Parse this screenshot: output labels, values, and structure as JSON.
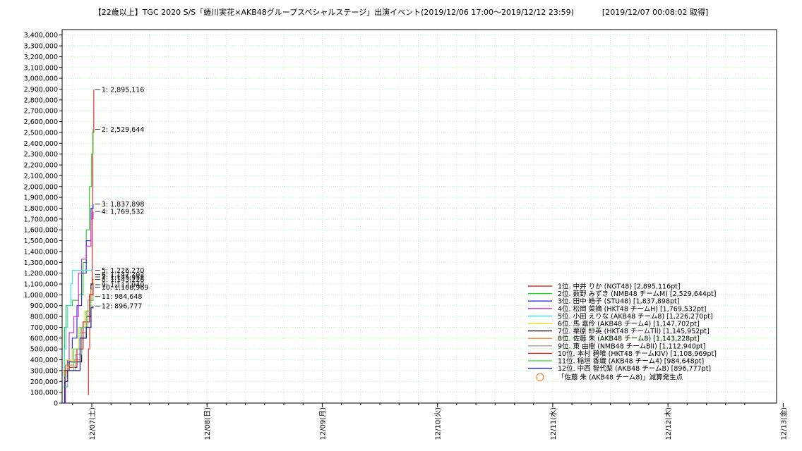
{
  "title": "【22歳以上】TGC 2020 S/S「蜷川実花×AKB48グループスペシャルステージ」出演イベント(2019/12/06 17:00〜2019/12/12 23:59)",
  "timestamp": "[2019/12/07 00:08:02 取得]",
  "chart_data": {
    "type": "line",
    "ylim": [
      0,
      3450000
    ],
    "grid": true,
    "legend_position": "bottom-right",
    "y_ticks": [
      "0",
      "100,000",
      "200,000",
      "300,000",
      "400,000",
      "500,000",
      "600,000",
      "700,000",
      "800,000",
      "900,000",
      "1,000,000",
      "1,100,000",
      "1,200,000",
      "1,300,000",
      "1,400,000",
      "1,500,000",
      "1,600,000",
      "1,700,000",
      "1,800,000",
      "1,900,000",
      "2,000,000",
      "2,100,000",
      "2,200,000",
      "2,300,000",
      "2,400,000",
      "2,500,000",
      "2,600,000",
      "2,700,000",
      "2,800,000",
      "2,900,000",
      "3,000,000",
      "3,100,000",
      "3,200,000",
      "3,300,000",
      "3,400,000"
    ],
    "x_ticks": [
      "12/07(土)",
      "12/08(日)",
      "12/09(月)",
      "12/10(火)",
      "12/11(水)",
      "12/12(木)",
      "12/13(金)"
    ],
    "annotations": [
      {
        "text": "1: 2,895,116",
        "value": 2895116
      },
      {
        "text": "2: 2,529,644",
        "value": 2529644
      },
      {
        "text": "3: 1,837,898",
        "value": 1837898
      },
      {
        "text": "4: 1,769,532",
        "value": 1769532
      },
      {
        "text": "5: 1,226,270",
        "value": 1226270
      },
      {
        "text": "6: 1,147,702",
        "value": 1147702
      },
      {
        "text": "7: 1,145,952",
        "value": 1145952
      },
      {
        "text": "8: 1,143,228",
        "value": 1143228
      },
      {
        "text": "9: 1,112,940",
        "value": 1112940
      },
      {
        "text": "10: 1,108,969",
        "value": 1108969
      },
      {
        "text": "11: 984,648",
        "value": 984648
      },
      {
        "text": "12: 896,777",
        "value": 896777
      }
    ],
    "series": [
      {
        "name": "1位. 中井 りか (NGT48) [2,895,116pt]",
        "color": "#e03030",
        "points": [
          [
            0.8,
            80000
          ],
          [
            0.82,
            500000
          ],
          [
            0.86,
            700000
          ],
          [
            0.9,
            1100000
          ],
          [
            0.94,
            1800000
          ],
          [
            0.96,
            2500000
          ],
          [
            0.99,
            2895116
          ]
        ]
      },
      {
        "name": "2位. 薮野 みずき (NMB48 チームM) [2,529,644pt]",
        "color": "#30d030",
        "points": [
          [
            0.02,
            0
          ],
          [
            0.05,
            700000
          ],
          [
            0.1,
            900000
          ],
          [
            0.3,
            950000
          ],
          [
            0.5,
            1000000
          ],
          [
            0.65,
            1300000
          ],
          [
            0.75,
            1600000
          ],
          [
            0.85,
            2000000
          ],
          [
            0.92,
            2300000
          ],
          [
            0.97,
            2529644
          ]
        ]
      },
      {
        "name": "3位. 田中 皓子 (STU48) [1,837,898pt]",
        "color": "#3030e0",
        "points": [
          [
            0.02,
            0
          ],
          [
            0.06,
            250000
          ],
          [
            0.15,
            400000
          ],
          [
            0.3,
            600000
          ],
          [
            0.45,
            900000
          ],
          [
            0.6,
            1200000
          ],
          [
            0.75,
            1500000
          ],
          [
            0.9,
            1800000
          ],
          [
            0.97,
            1837898
          ]
        ]
      },
      {
        "name": "4位. 松岡 菜摘 (HKT48 チームH) [1,769,532pt]",
        "color": "#d030d0",
        "points": [
          [
            0.02,
            0
          ],
          [
            0.08,
            350000
          ],
          [
            0.2,
            650000
          ],
          [
            0.35,
            800000
          ],
          [
            0.5,
            1200000
          ],
          [
            0.6,
            1330000
          ],
          [
            0.75,
            1450000
          ],
          [
            0.9,
            1700000
          ],
          [
            0.97,
            1769532
          ]
        ]
      },
      {
        "name": "5位. 小田 えりな (AKB48 チーム8) [1,226,270pt]",
        "color": "#40e0e0",
        "points": [
          [
            0.02,
            300000
          ],
          [
            0.05,
            500000
          ],
          [
            0.1,
            700000
          ],
          [
            0.15,
            900000
          ],
          [
            0.25,
            1100000
          ],
          [
            0.3,
            1226270
          ],
          [
            0.97,
            1226270
          ]
        ]
      },
      {
        "name": "6位. 馬 嘉伶 (AKB48 チーム4) [1,147,702pt]",
        "color": "#e0e030",
        "points": [
          [
            0.02,
            200000
          ],
          [
            0.1,
            400000
          ],
          [
            0.3,
            500000
          ],
          [
            0.5,
            700000
          ],
          [
            0.7,
            850000
          ],
          [
            0.85,
            1000000
          ],
          [
            0.97,
            1147702
          ]
        ]
      },
      {
        "name": "7位. 栗原 紗英 (HKT48 チームTII) [1,145,952pt]",
        "color": "#202020",
        "points": [
          [
            0.02,
            300000
          ],
          [
            0.2,
            380000
          ],
          [
            0.5,
            380000
          ],
          [
            0.6,
            600000
          ],
          [
            0.75,
            800000
          ],
          [
            0.9,
            1100000
          ],
          [
            0.97,
            1145952
          ]
        ]
      },
      {
        "name": "8位. 佐藤 朱 (AKB48 チーム8) [1,143,228pt]",
        "color": "#f08030",
        "points": [
          [
            0.02,
            280000
          ],
          [
            0.15,
            350000
          ],
          [
            0.35,
            400000
          ],
          [
            0.55,
            650000
          ],
          [
            0.75,
            850000
          ],
          [
            0.9,
            1050000
          ],
          [
            0.97,
            1143228
          ]
        ]
      },
      {
        "name": "9位. 東 由樹 (NMB48 チームBII) [1,112,940pt]",
        "color": "#a0a0a0",
        "points": [
          [
            0.02,
            250000
          ],
          [
            0.15,
            300000
          ],
          [
            0.4,
            450000
          ],
          [
            0.6,
            700000
          ],
          [
            0.8,
            950000
          ],
          [
            0.97,
            1112940
          ]
        ]
      },
      {
        "name": "10位. 本村 碧唯 (HKT48 チームKIV) [1,108,969pt]",
        "color": "#c02020",
        "points": [
          [
            0.02,
            300000
          ],
          [
            0.2,
            330000
          ],
          [
            0.45,
            500000
          ],
          [
            0.65,
            750000
          ],
          [
            0.85,
            1000000
          ],
          [
            0.97,
            1108969
          ]
        ]
      },
      {
        "name": "11位. 稲垣 香織 (AKB48 チーム4) [984,648pt]",
        "color": "#60d060",
        "points": [
          [
            0.02,
            150000
          ],
          [
            0.15,
            300000
          ],
          [
            0.35,
            500000
          ],
          [
            0.55,
            700000
          ],
          [
            0.75,
            850000
          ],
          [
            0.9,
            950000
          ],
          [
            0.97,
            984648
          ]
        ]
      },
      {
        "name": "12位. 中西 智代梨 (AKB48 チームB) [896,777pt]",
        "color": "#2020a0",
        "points": [
          [
            0.02,
            0
          ],
          [
            0.06,
            200000
          ],
          [
            0.15,
            300000
          ],
          [
            0.45,
            300000
          ],
          [
            0.55,
            600000
          ],
          [
            0.75,
            700000
          ],
          [
            0.9,
            880000
          ],
          [
            0.97,
            896777
          ]
        ]
      }
    ],
    "marker_legend": {
      "text": "「佐藤 朱 (AKB48 チーム8)」減算発生点",
      "color": "#f08030"
    }
  }
}
